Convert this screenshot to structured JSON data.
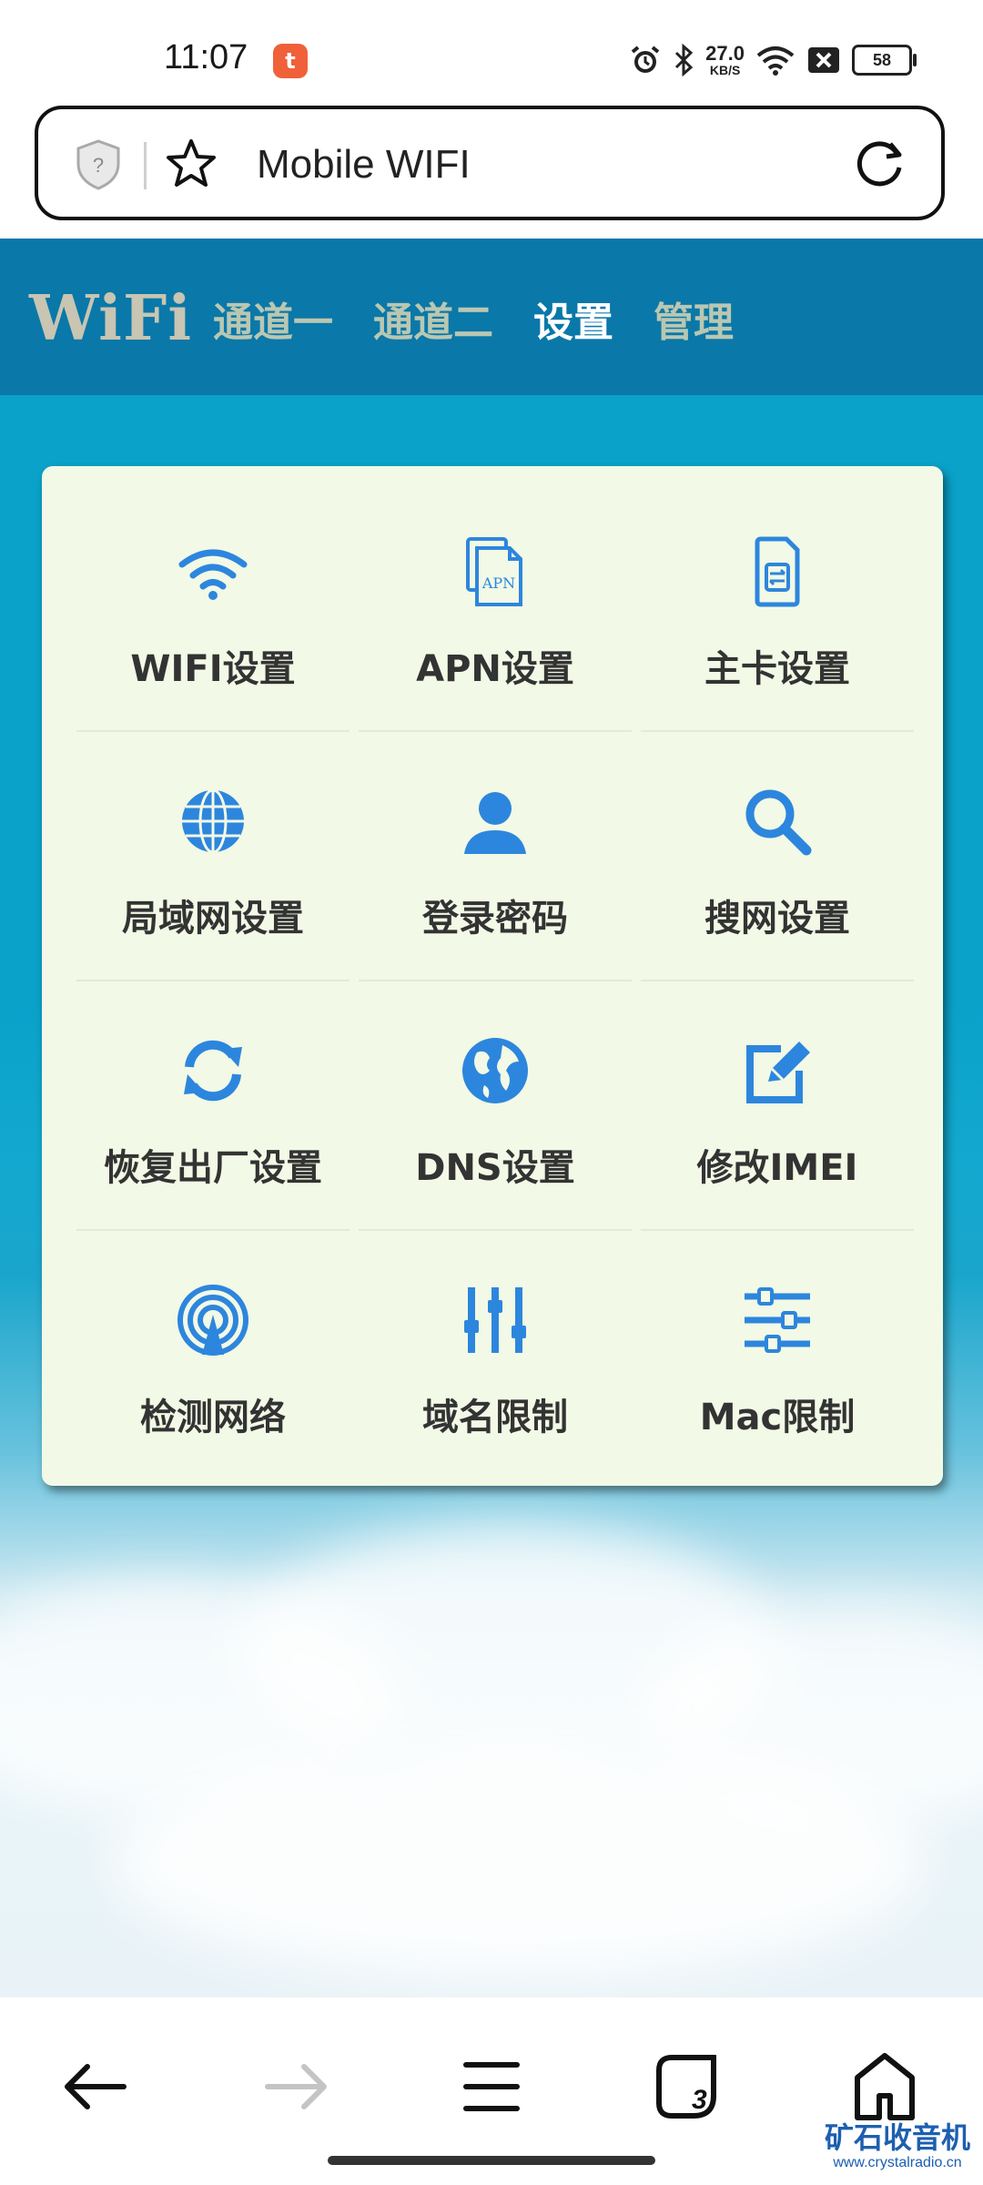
{
  "status_bar": {
    "time": "11:07",
    "app_badge": "t",
    "net_speed_value": "27.0",
    "net_speed_unit": "KB/S",
    "battery": "58",
    "icons": [
      "alarm-icon",
      "bluetooth-icon",
      "wifi-icon",
      "sim-off-icon",
      "battery-icon"
    ]
  },
  "browser": {
    "url_title": "Mobile WIFI"
  },
  "site": {
    "logo": "WiFi",
    "nav": [
      {
        "label": "通道一",
        "active": false
      },
      {
        "label": "通道二",
        "active": false
      },
      {
        "label": "设置",
        "active": true
      },
      {
        "label": "管理",
        "active": false
      }
    ]
  },
  "settings": {
    "tiles": [
      {
        "label": "WIFI设置",
        "icon": "wifi-icon"
      },
      {
        "label": "APN设置",
        "icon": "apn-document-icon"
      },
      {
        "label": "主卡设置",
        "icon": "sim-card-icon"
      },
      {
        "label": "局域网设置",
        "icon": "globe-icon"
      },
      {
        "label": "登录密码",
        "icon": "user-icon"
      },
      {
        "label": "搜网设置",
        "icon": "search-icon"
      },
      {
        "label": "恢复出厂设置",
        "icon": "refresh-icon"
      },
      {
        "label": "DNS设置",
        "icon": "earth-icon"
      },
      {
        "label": "修改IMEI",
        "icon": "edit-icon"
      },
      {
        "label": "检测网络",
        "icon": "broadcast-icon"
      },
      {
        "label": "域名限制",
        "icon": "sliders-vertical-icon"
      },
      {
        "label": "Mac限制",
        "icon": "sliders-horizontal-icon"
      }
    ]
  },
  "bottom_nav": {
    "tab_count": "3"
  },
  "watermark": {
    "line1": "矿石收音机",
    "line2": "www.crystalradio.cn"
  },
  "colors": {
    "header_bg": "#0a78a8",
    "page_bg": "#0aa2c9",
    "card_bg": "#f2f9e6",
    "icon_blue": "#2d86dd"
  }
}
